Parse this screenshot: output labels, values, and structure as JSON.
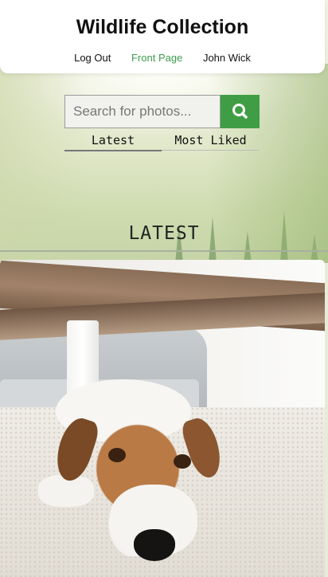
{
  "header": {
    "title": "Wildlife Collection",
    "nav": [
      {
        "label": "Log Out",
        "active": false
      },
      {
        "label": "Front Page",
        "active": true
      },
      {
        "label": "John Wick",
        "active": false
      }
    ]
  },
  "search": {
    "placeholder": "Search for photos...",
    "value": "",
    "button_icon": "search-icon"
  },
  "tabs": [
    {
      "label": "Latest",
      "selected": true
    },
    {
      "label": "Most Liked",
      "selected": false
    }
  ],
  "section": {
    "heading": "LATEST"
  },
  "photos": [
    {
      "subject": "dog lying under table"
    }
  ],
  "colors": {
    "accent": "#3f9e45",
    "active_nav": "#3e9b4e",
    "header_bg": "#ffffff"
  }
}
